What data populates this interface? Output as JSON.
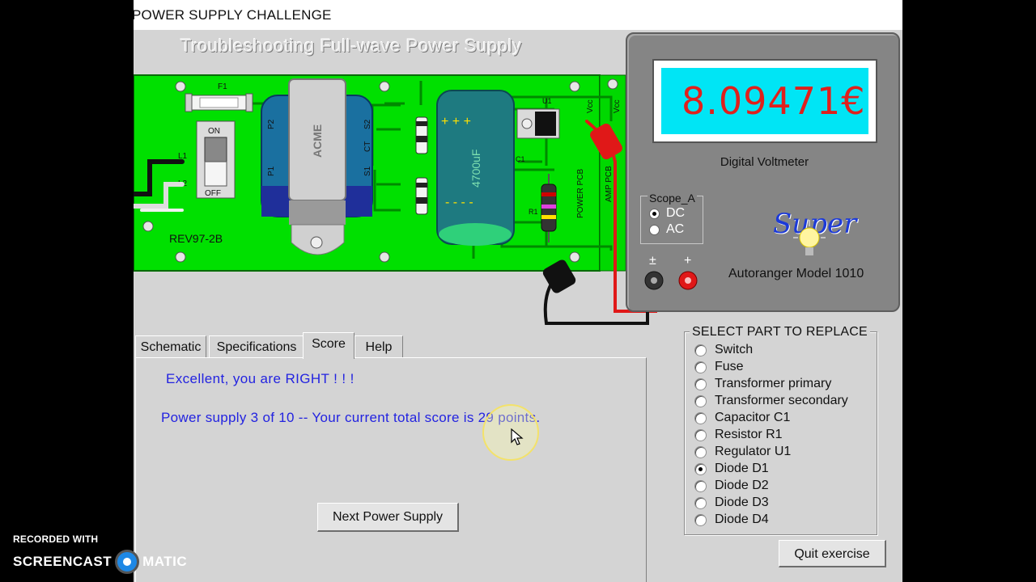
{
  "window": {
    "title": "POWER SUPPLY CHALLENGE"
  },
  "board": {
    "title": "Troubleshooting Full-wave Power Supply",
    "revision": "REV97-2B",
    "switch_on": "ON",
    "switch_off": "OFF",
    "transformer_brand": "ACME",
    "capacitor_value": "4700uF",
    "labels": {
      "fuse": "F1",
      "l1": "L1",
      "l2": "L2",
      "g": "G",
      "p1": "P1",
      "p2": "P2",
      "s1": "S1",
      "s2": "S2",
      "ct": "CT",
      "d1": "D1",
      "d2": "D2",
      "c1": "C1",
      "r1": "R1",
      "u1": "U1",
      "vcc": "Vcc",
      "power_pcb": "POWER PCB",
      "amp_pcb": "AMP PCB"
    }
  },
  "meter": {
    "reading": "8.09471€",
    "name": "Digital Voltmeter",
    "model": "Autoranger Model 1010",
    "brand": "Super",
    "scope_title": "Scope_A",
    "scope_options": [
      {
        "label": "DC",
        "selected": true
      },
      {
        "label": "AC",
        "selected": false
      }
    ],
    "jack_minus": "±",
    "jack_plus": "+"
  },
  "tabs": [
    {
      "label": "Schematic",
      "active": false
    },
    {
      "label": "Specifications",
      "active": false
    },
    {
      "label": "Score",
      "active": true
    },
    {
      "label": "Help",
      "active": false
    }
  ],
  "score": {
    "result_message": "Excellent, you are RIGHT ! ! !",
    "score_message": "Power supply 3 of 10 -- Your current total score is 29 points.",
    "next_button": "Next Power Supply"
  },
  "parts": {
    "title": "SELECT PART TO REPLACE",
    "options": [
      {
        "label": "Switch",
        "selected": false
      },
      {
        "label": "Fuse",
        "selected": false
      },
      {
        "label": "Transformer primary",
        "selected": false
      },
      {
        "label": "Transformer secondary",
        "selected": false
      },
      {
        "label": "Capacitor C1",
        "selected": false
      },
      {
        "label": "Resistor R1",
        "selected": false
      },
      {
        "label": "Regulator U1",
        "selected": false
      },
      {
        "label": "Diode D1",
        "selected": true
      },
      {
        "label": "Diode D2",
        "selected": false
      },
      {
        "label": "Diode D3",
        "selected": false
      },
      {
        "label": "Diode D4",
        "selected": false
      }
    ]
  },
  "quit_button": "Quit exercise",
  "watermark": {
    "top": "RECORDED WITH",
    "left": "SCREENCAST",
    "right": "MATIC"
  },
  "colors": {
    "pcb": "#00e000",
    "display": "#00e5f5",
    "reading": "#e0201c",
    "message": "#2323e0",
    "meter_body": "#858585"
  }
}
